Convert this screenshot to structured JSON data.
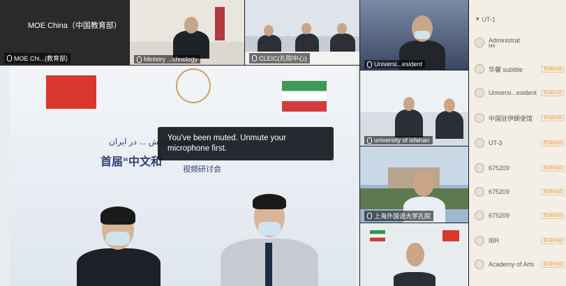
{
  "tiles": {
    "moe_china_name": "MOE China（中国教育部）",
    "moe_china_self": "MOE Chi...(教育部)",
    "ministry": "Ministry ...chnology",
    "cleic": "CLEIC(孔院中心)",
    "university_president": "Universi...esident",
    "university_isfahan": "university of isfahan",
    "shanghai": "上海外国语大学孔院"
  },
  "stage": {
    "banner_ar": "نخستین همایش ... در ایران",
    "banner_cn": "首届“中文和",
    "banner_cn2": "视频研讨会"
  },
  "toast": {
    "message": "You've been muted. Unmute your microphone first."
  },
  "participants": {
    "header": "UT-1",
    "items": [
      {
        "name": "Administrat",
        "sub": "Me",
        "tag": ""
      },
      {
        "name": "华馨 subtitle",
        "sub": "",
        "tag": "External"
      },
      {
        "name": "Universi...esident",
        "sub": "",
        "tag": "External"
      },
      {
        "name": "中国驻伊朗使馆",
        "sub": "",
        "tag": "External"
      },
      {
        "name": "UT-3",
        "sub": "",
        "tag": "External"
      },
      {
        "name": "675209",
        "sub": "",
        "tag": "External"
      },
      {
        "name": "675209",
        "sub": "",
        "tag": "External"
      },
      {
        "name": "675209",
        "sub": "",
        "tag": "External"
      },
      {
        "name": "IBR",
        "sub": "",
        "tag": "External"
      },
      {
        "name": "Academy of Arts",
        "sub": "",
        "tag": "External"
      }
    ]
  }
}
